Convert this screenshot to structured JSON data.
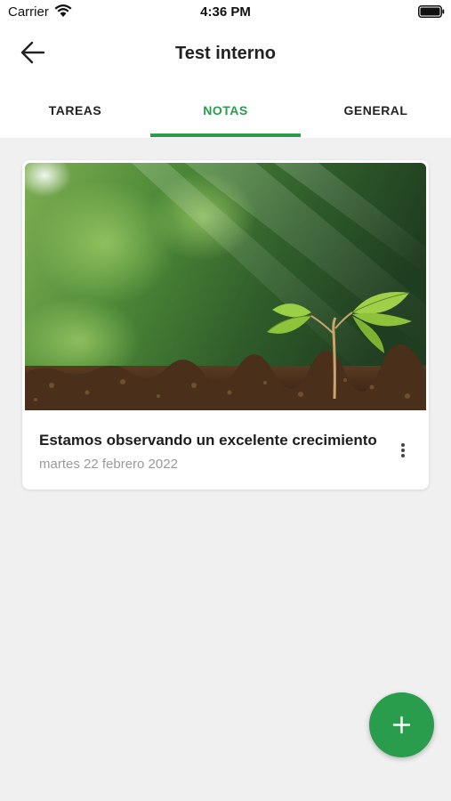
{
  "status_bar": {
    "carrier": "Carrier",
    "time": "4:36 PM"
  },
  "header": {
    "title": "Test interno"
  },
  "tabs": [
    {
      "label": "TAREAS",
      "active": false
    },
    {
      "label": "NOTAS",
      "active": true
    },
    {
      "label": "GENERAL",
      "active": false
    }
  ],
  "notes": [
    {
      "title": "Estamos observando un excelente crecimiento",
      "date": "martes 22 febrero 2022"
    }
  ],
  "icons": {
    "back": "arrow-left-icon",
    "more": "more-vertical-icon",
    "add": "plus-icon"
  },
  "colors": {
    "accent": "#2a9d4d",
    "background": "#f0f0f0"
  }
}
